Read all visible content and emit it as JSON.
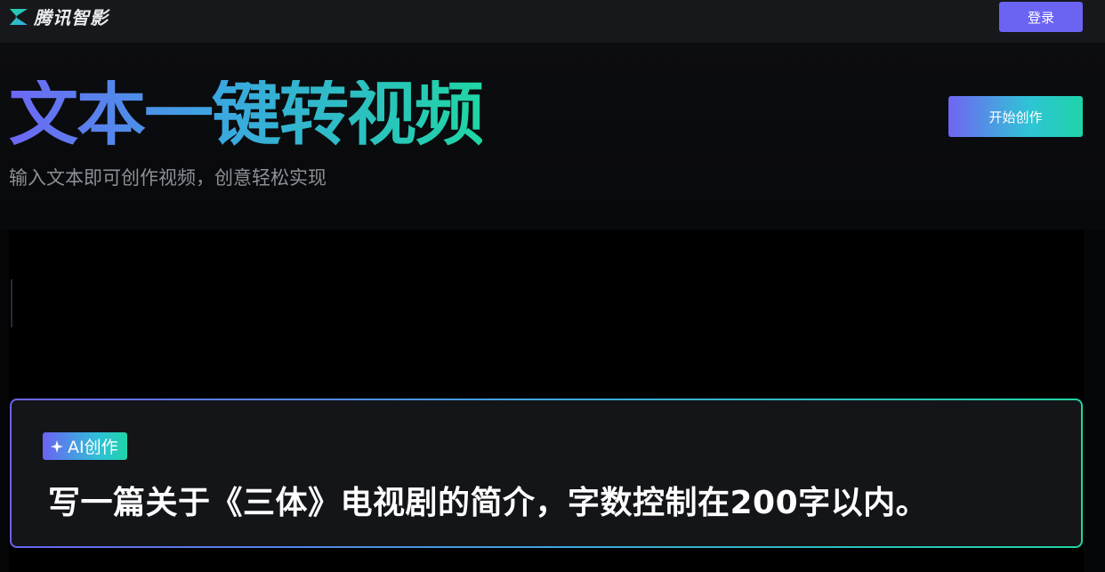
{
  "header": {
    "brand_name": "腾讯智影",
    "login_label": "登录"
  },
  "hero": {
    "title": "文本一键转视频",
    "subtitle": "输入文本即可创作视频，创意轻松实现",
    "start_label": "开始创作"
  },
  "prompt_card": {
    "badge_label": "AI创作",
    "badge_icon": "sparkle-icon",
    "prompt_text": "写一篇关于《三体》电视剧的简介，字数控制在200字以内。"
  },
  "colors": {
    "accent_purple": "#6b63f2",
    "accent_cyan": "#3fa6e0",
    "accent_green": "#1fd6a4",
    "background": "#050607"
  }
}
